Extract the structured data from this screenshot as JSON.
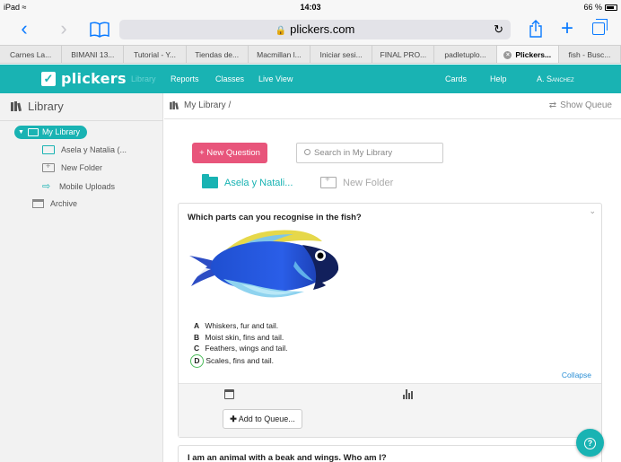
{
  "status_bar": {
    "device": "iPad",
    "wifi_icon": "wifi-icon",
    "time": "14:03",
    "battery": "66 %"
  },
  "browser": {
    "url": "plickers.com",
    "tabs": [
      {
        "label": "Carnes La..."
      },
      {
        "label": "BIMANI 13..."
      },
      {
        "label": "Tutorial - Y..."
      },
      {
        "label": "Tiendas de..."
      },
      {
        "label": "Macmillan l..."
      },
      {
        "label": "Iniciar sesi..."
      },
      {
        "label": "FINAL PRO..."
      },
      {
        "label": "padletuplo..."
      },
      {
        "label": "Plickers..."
      },
      {
        "label": "fish - Busc..."
      }
    ]
  },
  "nav": {
    "brand": "plickers",
    "links": {
      "library": "Library",
      "reports": "Reports",
      "classes": "Classes",
      "live_view": "Live View"
    },
    "right": {
      "cards": "Cards",
      "help": "Help",
      "user": "A. Sanchez"
    },
    "colors": {
      "brand": "#19b3b3",
      "accent_pink": "#e8557b"
    }
  },
  "sidebar": {
    "title": "Library",
    "my_library": "My Library",
    "items": [
      {
        "label": "Asela y Natalia (..."
      },
      {
        "label": "New Folder"
      },
      {
        "label": "Mobile Uploads"
      }
    ],
    "archive": "Archive"
  },
  "main": {
    "breadcrumb": "My Library  /",
    "show_queue": "Show Queue",
    "new_question": "+ New Question",
    "search_placeholder": "Search in My Library",
    "folders": [
      {
        "label": "Asela y Natali..."
      },
      {
        "label": "New Folder"
      }
    ],
    "question": {
      "text": "Which parts can you recognise in the fish?",
      "answers": [
        {
          "letter": "A",
          "text": "Whiskers, fur and tail."
        },
        {
          "letter": "B",
          "text": "Moist skin, fins and tail."
        },
        {
          "letter": "C",
          "text": "Feathers, wings and tail."
        },
        {
          "letter": "D",
          "text": "Scales, fins and tail.",
          "correct": true
        }
      ],
      "collapse": "Collapse",
      "add_to_queue": "Add to Queue..."
    },
    "question2": {
      "text": "I am an animal with a beak and wings. Who am I?"
    }
  },
  "help_button": {
    "icon": "question-icon"
  }
}
